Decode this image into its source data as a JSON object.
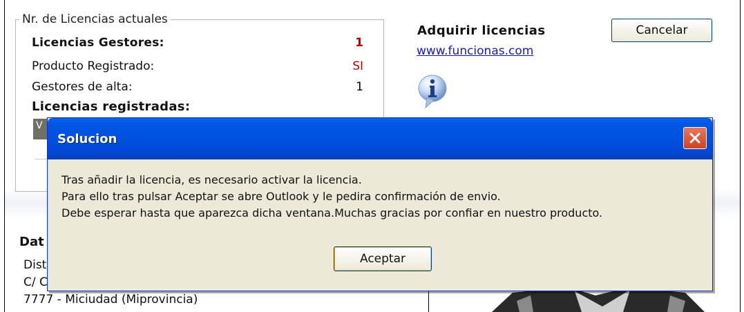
{
  "licenses": {
    "group_title": "Nr. de Licencias actuales",
    "gestores_label": "Licencias Gestores:",
    "gestores_value": "1",
    "registrado_label": "Producto Registrado:",
    "registrado_value": "SI",
    "alta_label": "Gestores de alta:",
    "alta_value": "1",
    "registradas_label": "Licencias registradas:",
    "stub_button_text": "V"
  },
  "acquire": {
    "title": "Adquirir licencias",
    "link": "www.funcionas.com",
    "info_icon": "info-bubble-icon"
  },
  "cancel_button": "Cancelar",
  "datos": {
    "title": "Dat",
    "line1": "Dist",
    "line2": "C/ C",
    "line3": "7777 - Miciudad (Miprovincia)"
  },
  "dialog": {
    "title": "Solucion",
    "close_icon": "close-icon",
    "messages": [
      "Tras añadir la licencia, es necesario activar la licencia.",
      "Para ello tras pulsar Aceptar se abre Outlook y le pedira confirmación de envio.",
      "Debe esperar hasta que aparezca dicha ventana.Muchas gracias por confiar en nuestro producto."
    ],
    "ok_button": "Aceptar"
  },
  "colors": {
    "titlebar": "#0055e5",
    "dialog_bg": "#ece9d8",
    "close_red": "#d2411f",
    "value_red": "#c00000",
    "link_blue": "#1a1ab4"
  }
}
